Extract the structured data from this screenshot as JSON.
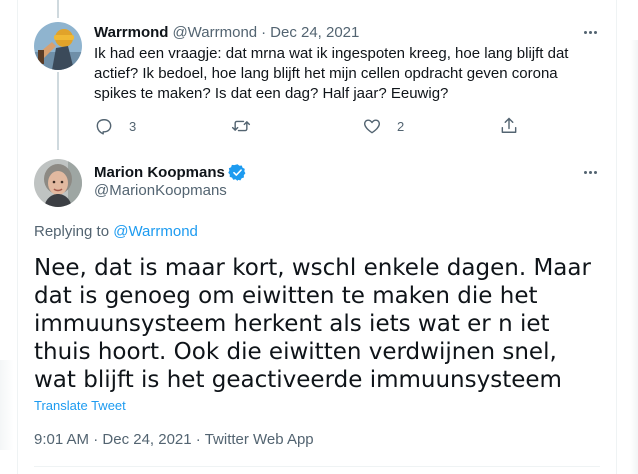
{
  "reply_tweet": {
    "author_name": "Warrmond",
    "author_handle": "@Warrmond",
    "separator": "·",
    "date": "Dec 24, 2021",
    "text": "Ik had een vraagje: dat mrna wat ik ingespoten kreeg, hoe lang blijft dat actief? Ik bedoel, hoe lang blijft het mijn cellen opdracht geven corona spikes te maken? Is dat een dag? Half jaar? Eeuwig?",
    "reply_count": "3",
    "retweet_count": "",
    "like_count": "2",
    "icons": {
      "avatar": "avatar-warrmond",
      "more": "more-icon",
      "reply": "reply-icon",
      "retweet": "retweet-icon",
      "like": "heart-icon",
      "share": "share-icon"
    }
  },
  "main_tweet": {
    "author_name": "Marion Koopmans",
    "author_handle": "@MarionKoopmans",
    "verified": true,
    "replying_to_label": "Replying to",
    "replying_to_handle": "@Warrmond",
    "text": "Nee, dat is maar kort, wschl enkele dagen. Maar dat is genoeg om eiwitten te maken die het immuunsysteem herkent als iets wat er n iet thuis hoort. Ook die eiwitten verdwijnen snel, wat blijft is het geactiveerde immuunsysteem",
    "translate_label": "Translate Tweet",
    "time": "9:01 AM",
    "date": "Dec 24, 2021",
    "separator": "·",
    "source": "Twitter Web App",
    "icons": {
      "avatar": "avatar-marion",
      "verified": "verified-badge-icon",
      "more": "more-icon"
    }
  },
  "colors": {
    "text": "#0f1419",
    "muted": "#536471",
    "link": "#1d9bf0",
    "border": "#eff3f4",
    "thread_line": "#cfd9de"
  }
}
